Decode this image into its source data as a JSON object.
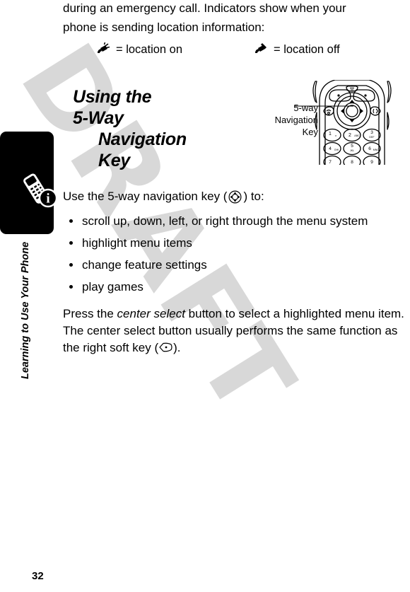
{
  "document": {
    "watermark_text": "DRAFT",
    "page_number": "32",
    "chapter_label": "Learning to Use Your Phone"
  },
  "intro": {
    "line1": "during an emergency call. Indicators show when your",
    "line2": "phone is sending location information:"
  },
  "legend": {
    "on": {
      "icon": "location-on-icon",
      "text": "= location on"
    },
    "off": {
      "icon": "location-off-icon",
      "text": "= location off"
    }
  },
  "heading": {
    "line1": "Using the",
    "line2": "5-Way",
    "line3": "Navigation",
    "line4": "Key"
  },
  "figure": {
    "caption_line1": "5-way",
    "caption_line2": "Navigation",
    "caption_line3": "Key",
    "art_name": "mobile-phone-keypad-illustration",
    "keys": [
      "1",
      "2 ABC",
      "3 DEF",
      "4 GHI",
      "5 JKL",
      "6 MNO",
      "7",
      "8",
      "9"
    ]
  },
  "lead": {
    "before_icon": "Use the 5-way navigation key (",
    "icon": "navigation-key-icon",
    "after_icon": ") to:"
  },
  "bullets": [
    "scroll up, down, left, or right through the menu system",
    "highlight menu items",
    "change feature settings",
    "play games"
  ],
  "closing": {
    "seg1": "Press the ",
    "em1": "center select",
    "seg2": " button to select a highlighted menu item. The center select button usually performs the same function as the right soft key (",
    "icon": "right-soft-key-icon",
    "seg3": ")."
  },
  "colors": {
    "text": "#000000",
    "watermark": "#d8d8d8",
    "tab": "#000000",
    "page_background": "#ffffff"
  }
}
